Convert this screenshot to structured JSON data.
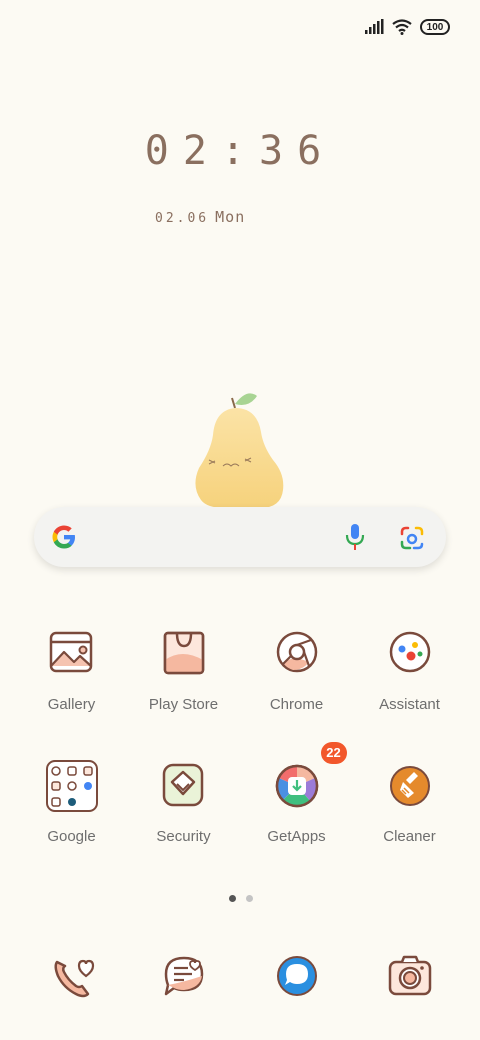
{
  "status": {
    "battery": "100"
  },
  "clock": {
    "time": "02:36",
    "date": "02.06",
    "day": "Mon"
  },
  "apps": [
    {
      "label": "Gallery",
      "icon": "gallery-icon"
    },
    {
      "label": "Play Store",
      "icon": "play-store-icon"
    },
    {
      "label": "Chrome",
      "icon": "chrome-icon"
    },
    {
      "label": "Assistant",
      "icon": "assistant-icon"
    },
    {
      "label": "Google",
      "icon": "google-folder-icon"
    },
    {
      "label": "Security",
      "icon": "security-icon"
    },
    {
      "label": "GetApps",
      "icon": "getapps-icon",
      "badge": "22"
    },
    {
      "label": "Cleaner",
      "icon": "cleaner-icon"
    }
  ],
  "dock": [
    {
      "icon": "phone-icon"
    },
    {
      "icon": "messages-icon"
    },
    {
      "icon": "browser-icon"
    },
    {
      "icon": "camera-icon"
    }
  ],
  "colors": {
    "background": "#fcfaf3",
    "line": "#7a4a3c",
    "accent": "#f5c3b0",
    "badge": "#f2572b"
  }
}
